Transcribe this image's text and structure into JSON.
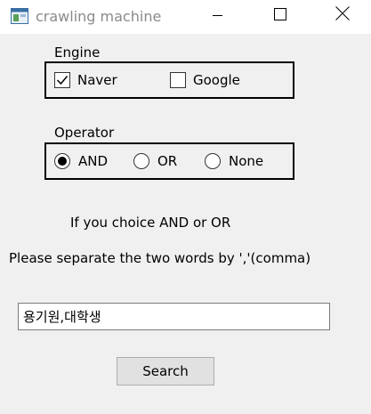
{
  "window": {
    "title": "crawling machine"
  },
  "engine": {
    "label": "Engine",
    "options": [
      {
        "label": "Naver",
        "checked": true
      },
      {
        "label": "Google",
        "checked": false
      }
    ]
  },
  "operator": {
    "label": "Operator",
    "options": [
      {
        "label": "AND",
        "selected": true
      },
      {
        "label": "OR",
        "selected": false
      },
      {
        "label": "None",
        "selected": false
      }
    ]
  },
  "instructions": {
    "line1": "If you choice AND or OR",
    "line2": "Please separate the two words by ','(comma)"
  },
  "search": {
    "value": "용기원,대학생",
    "button_label": "Search"
  },
  "icons": {
    "app": "app-window-icon",
    "minimize": "minimize-icon",
    "maximize": "maximize-icon",
    "close": "close-icon",
    "check": "checkmark-icon"
  }
}
